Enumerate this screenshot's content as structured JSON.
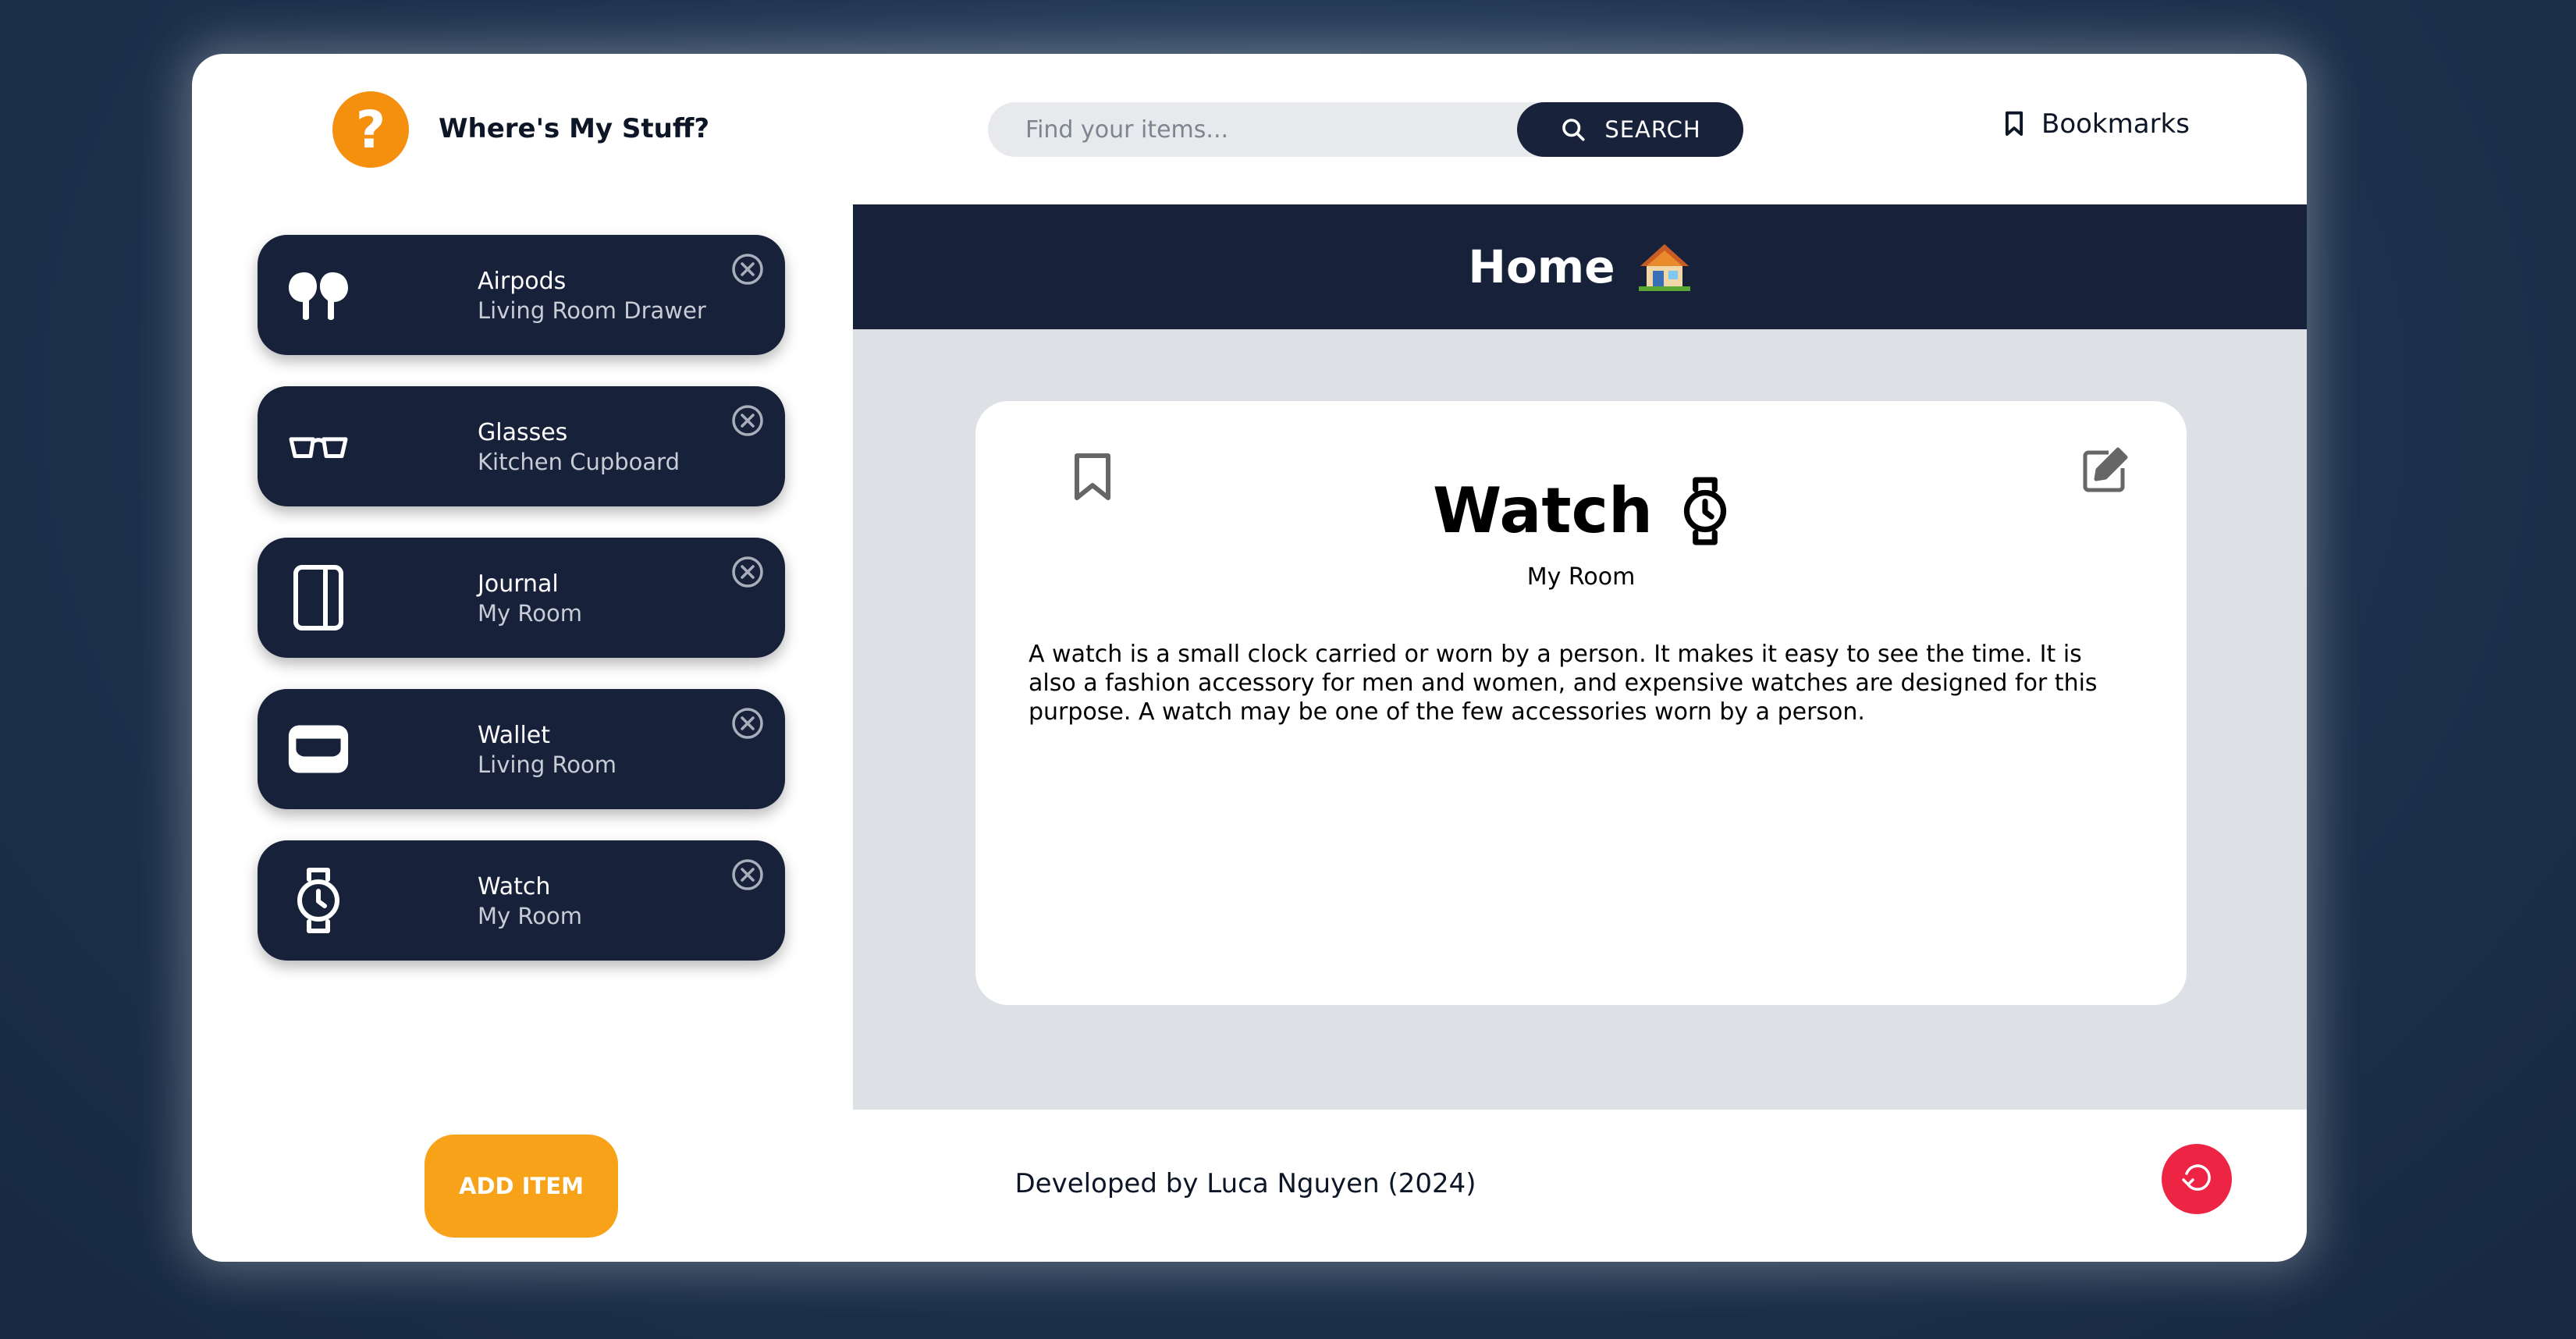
{
  "header": {
    "logo_glyph": "?",
    "app_title": "Where's My Stuff?",
    "search": {
      "placeholder": "Find your items...",
      "button_label": "SEARCH"
    },
    "bookmarks_label": "Bookmarks"
  },
  "sidebar": {
    "items": [
      {
        "name": "Airpods",
        "location": "Living Room Drawer",
        "icon": "airpods-icon"
      },
      {
        "name": "Glasses",
        "location": "Kitchen Cupboard",
        "icon": "glasses-icon"
      },
      {
        "name": "Journal",
        "location": "My Room",
        "icon": "journal-icon"
      },
      {
        "name": "Wallet",
        "location": "Living Room",
        "icon": "wallet-icon"
      },
      {
        "name": "Watch",
        "location": "My Room",
        "icon": "watch-icon"
      }
    ],
    "add_button_label": "ADD ITEM"
  },
  "main": {
    "title": "Home",
    "title_emoji": "house-icon",
    "card": {
      "title": "Watch",
      "subtitle": "My Room",
      "description": "A watch is a small clock carried or worn by a person. It makes it easy to see the time. It is also a fashion accessory for men and women, and expensive watches are designed for this purpose. A watch may be one of the few accessories worn by a person."
    }
  },
  "footer": {
    "credit": "Developed by Luca Nguyen (2024)"
  },
  "colors": {
    "navy": "#18213a",
    "accent_orange": "#f5900e",
    "add_button": "#f8a21a",
    "reset_red": "#ee2444",
    "main_bg": "#dde1e6"
  }
}
